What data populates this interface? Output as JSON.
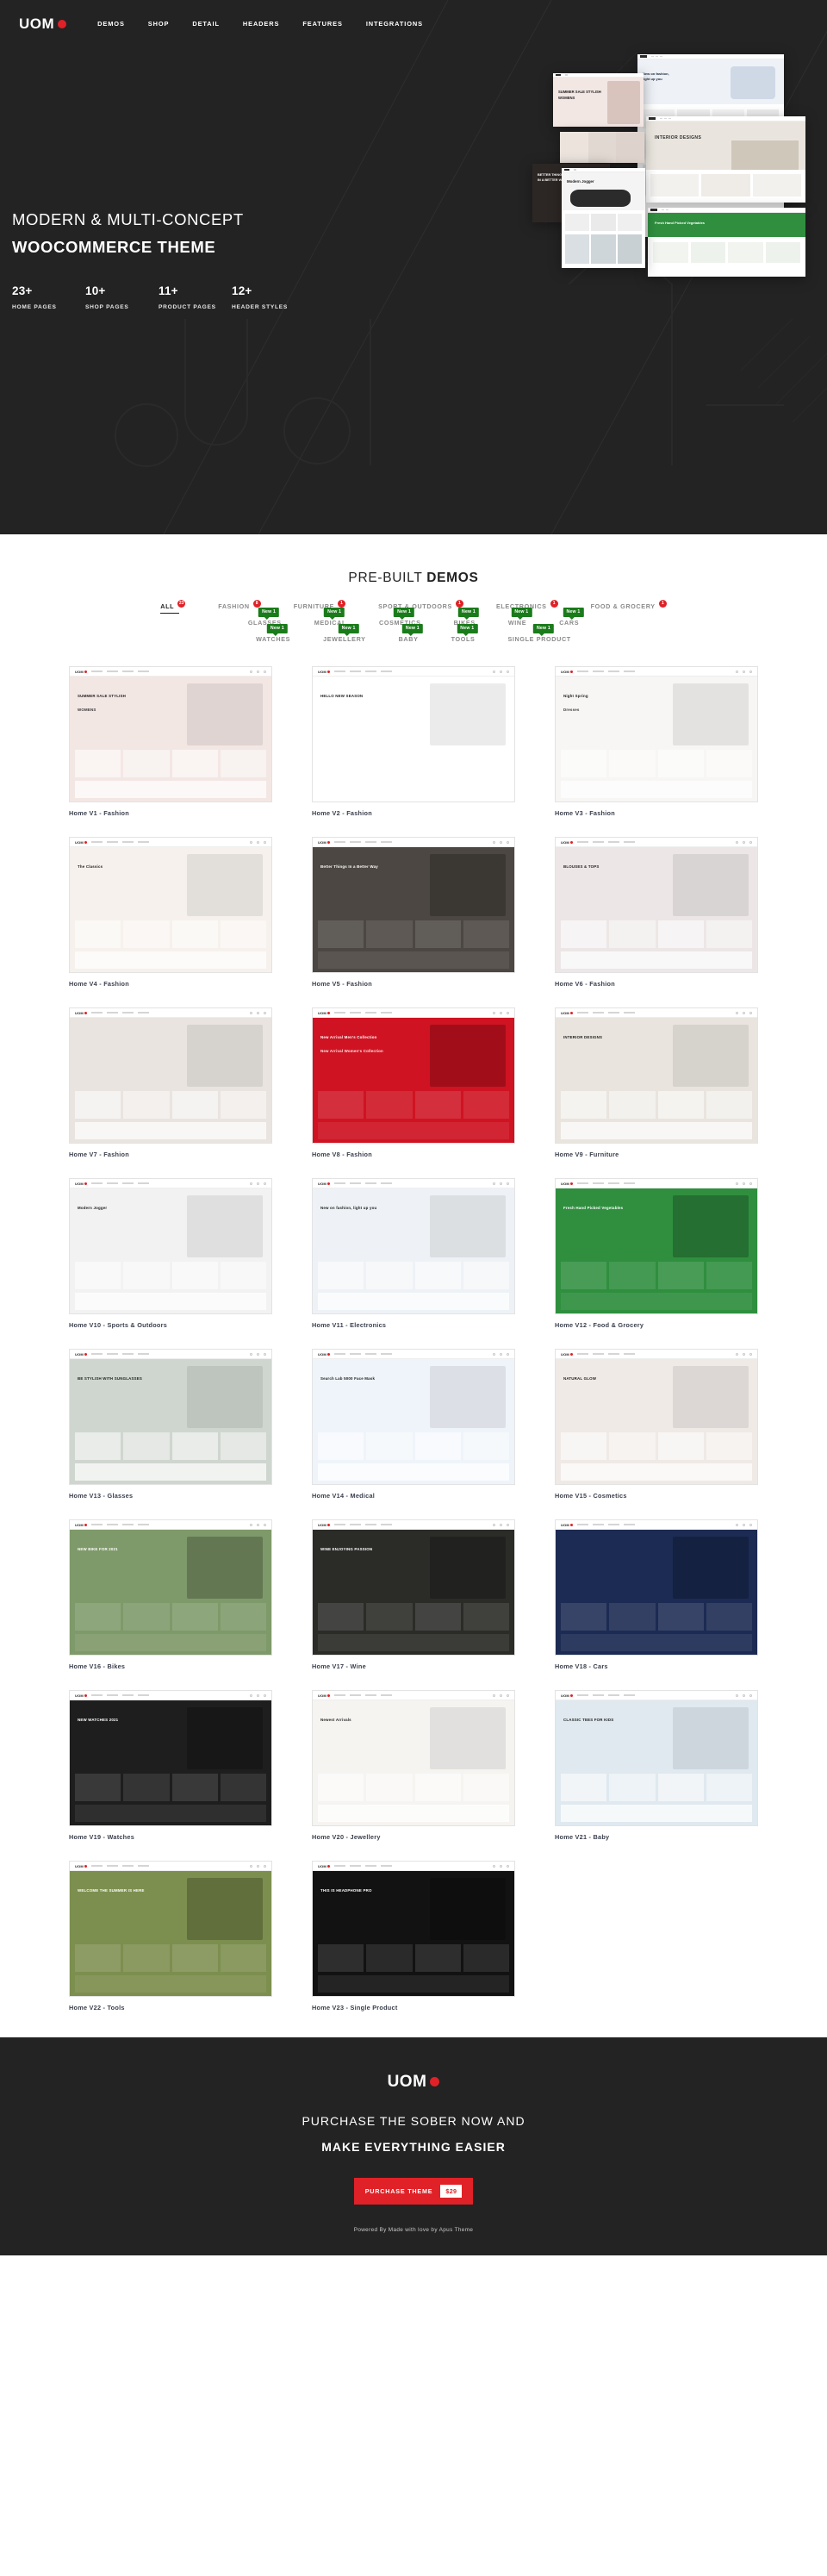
{
  "brand": {
    "name": "UOM",
    "dot_color": "#e02127"
  },
  "nav": {
    "items": [
      {
        "label": "DEMOS"
      },
      {
        "label": "SHOP"
      },
      {
        "label": "DETAIL"
      },
      {
        "label": "HEADERS"
      },
      {
        "label": "FEATURES"
      },
      {
        "label": "INTEGRATIONS"
      }
    ]
  },
  "hero": {
    "title_line1": "MODERN & MULTI-CONCEPT",
    "title_line2": "WOOCOMMERCE THEME",
    "stats": [
      {
        "number": "23+",
        "label": "HOME PAGES"
      },
      {
        "number": "10+",
        "label": "SHOP PAGES"
      },
      {
        "number": "11+",
        "label": "PRODUCT PAGES"
      },
      {
        "number": "12+",
        "label": "HEADER STYLES"
      }
    ]
  },
  "demos": {
    "title_light": "PRE-BUILT ",
    "title_bold": "DEMOS",
    "filters": [
      [
        {
          "label": "ALL",
          "count": "23",
          "active": true,
          "new": null
        },
        {
          "label": "FASHION",
          "count": "8",
          "active": false,
          "new": null
        },
        {
          "label": "FURNITURE",
          "count": "1",
          "active": false,
          "new": null
        },
        {
          "label": "SPORT & OUTDOORS",
          "count": "1",
          "active": false,
          "new": null
        },
        {
          "label": "ELECTRONICS",
          "count": "1",
          "active": false,
          "new": null
        },
        {
          "label": "FOOD & GROCERY",
          "count": "1",
          "active": false,
          "new": null
        }
      ],
      [
        {
          "label": "GLASSES",
          "count": null,
          "active": false,
          "new": "New 1"
        },
        {
          "label": "MEDICAL",
          "count": null,
          "active": false,
          "new": "New 1"
        },
        {
          "label": "COSMETICS",
          "count": null,
          "active": false,
          "new": "New 1"
        },
        {
          "label": "BIKES",
          "count": null,
          "active": false,
          "new": "New 1"
        },
        {
          "label": "WINE",
          "count": null,
          "active": false,
          "new": "New 1"
        },
        {
          "label": "CARS",
          "count": null,
          "active": false,
          "new": "New 1"
        }
      ],
      [
        {
          "label": "WATCHES",
          "count": null,
          "active": false,
          "new": "New 1"
        },
        {
          "label": "JEWELLERY",
          "count": null,
          "active": false,
          "new": "New 1"
        },
        {
          "label": "BABY",
          "count": null,
          "active": false,
          "new": "New 1"
        },
        {
          "label": "TOOLS",
          "count": null,
          "active": false,
          "new": "New 1"
        },
        {
          "label": "SINGLE PRODUCT",
          "count": null,
          "active": false,
          "new": "New 1"
        }
      ]
    ],
    "cards": [
      {
        "label": "Home V1 - Fashion",
        "headline": "SUMMER SALE STYLISH",
        "subhead": "WOMENS",
        "bg": "#f3e7e4",
        "style": "hero-left"
      },
      {
        "label": "Home V2 - Fashion",
        "headline": "HELLO NEW SEASON",
        "subhead": "",
        "bg": "#ffffff",
        "style": "hero-split"
      },
      {
        "label": "Home V3 - Fashion",
        "headline": "Night Spring",
        "subhead": "Dresses",
        "bg": "#f7f6f4",
        "style": "center-model"
      },
      {
        "label": "Home V4 - Fashion",
        "headline": "The Classics",
        "subhead": "",
        "bg": "#f6f1ec",
        "style": "circle"
      },
      {
        "label": "Home V5 - Fashion",
        "headline": "Better Things In a Better Way",
        "subhead": "",
        "bg": "#4c4742",
        "style": "dark-photo"
      },
      {
        "label": "Home V6 - Fashion",
        "headline": "BLOUSES & TOPS",
        "subhead": "",
        "bg": "#ece7e6",
        "style": "split-card"
      },
      {
        "label": "Home V7 - Fashion",
        "headline": "",
        "subhead": "",
        "bg": "#e9e4e0",
        "style": "models-row"
      },
      {
        "label": "Home V8 - Fashion",
        "headline": "New Arrival Men's Collection",
        "subhead": "New Arrival Women's Collection",
        "bg": "#cf1322",
        "style": "red-split"
      },
      {
        "label": "Home V9 - Furniture",
        "headline": "INTERIOR DESIGNS",
        "subhead": "",
        "bg": "#e9e5de",
        "style": "interior"
      },
      {
        "label": "Home V10 - Sports & Outdoors",
        "headline": "Modern Jogger",
        "subhead": "",
        "bg": "#f2f2f2",
        "style": "shoe"
      },
      {
        "label": "Home V11 - Electronics",
        "headline": "New on fashion, light up you",
        "subhead": "",
        "bg": "#eef2f6",
        "style": "watch"
      },
      {
        "label": "Home V12 - Food & Grocery",
        "headline": "Fresh Hand Picked Vegetables",
        "subhead": "",
        "bg": "#2f8f3f",
        "style": "grocery"
      },
      {
        "label": "Home V13 - Glasses",
        "headline": "BE STYLISH WITH SUNGLASSES",
        "subhead": "",
        "bg": "#cfd6cf",
        "style": "glasses"
      },
      {
        "label": "Home V14 - Medical",
        "headline": "Search Lab 5000 Face Mask",
        "subhead": "",
        "bg": "#eff4fa",
        "style": "medical"
      },
      {
        "label": "Home V15 - Cosmetics",
        "headline": "NATURAL GLOW",
        "subhead": "",
        "bg": "#efeae6",
        "style": "cosmetics"
      },
      {
        "label": "Home V16 - Bikes",
        "headline": "NEW BIKE FOR 2021",
        "subhead": "",
        "bg": "#7f9a6a",
        "style": "bikes"
      },
      {
        "label": "Home V17 - Wine",
        "headline": "WINE ENJOYING PASSION",
        "subhead": "",
        "bg": "#2b2b28",
        "style": "wine"
      },
      {
        "label": "Home V18 - Cars",
        "headline": "",
        "subhead": "",
        "bg": "#1c2b53",
        "style": "cars"
      },
      {
        "label": "Home V19 - Watches",
        "headline": "NEW WATCHES 2021",
        "subhead": "",
        "bg": "#1e1e1e",
        "style": "watches"
      },
      {
        "label": "Home V20 - Jewellery",
        "headline": "Newest Arrivals",
        "subhead": "",
        "bg": "#f6f4f1",
        "style": "jewellery"
      },
      {
        "label": "Home V21 - Baby",
        "headline": "CLASSIC TEES FOR KIDS",
        "subhead": "",
        "bg": "#dfe9ef",
        "style": "baby"
      },
      {
        "label": "Home V22 - Tools",
        "headline": "WELCOME THE SUMMER IS HERE",
        "subhead": "",
        "bg": "#7d8f4f",
        "style": "tools"
      },
      {
        "label": "Home V23 - Single Product",
        "headline": "THIS IS HEADPHONE PRO",
        "subhead": "",
        "bg": "#121212",
        "style": "single"
      }
    ]
  },
  "cta": {
    "line1": "PURCHASE THE SOBER NOW AND",
    "line2": "MAKE EVERYTHING EASIER",
    "button_label": "PURCHASE THEME",
    "button_price": "$29",
    "credit": "Powered By Made with love by Apus Theme"
  }
}
